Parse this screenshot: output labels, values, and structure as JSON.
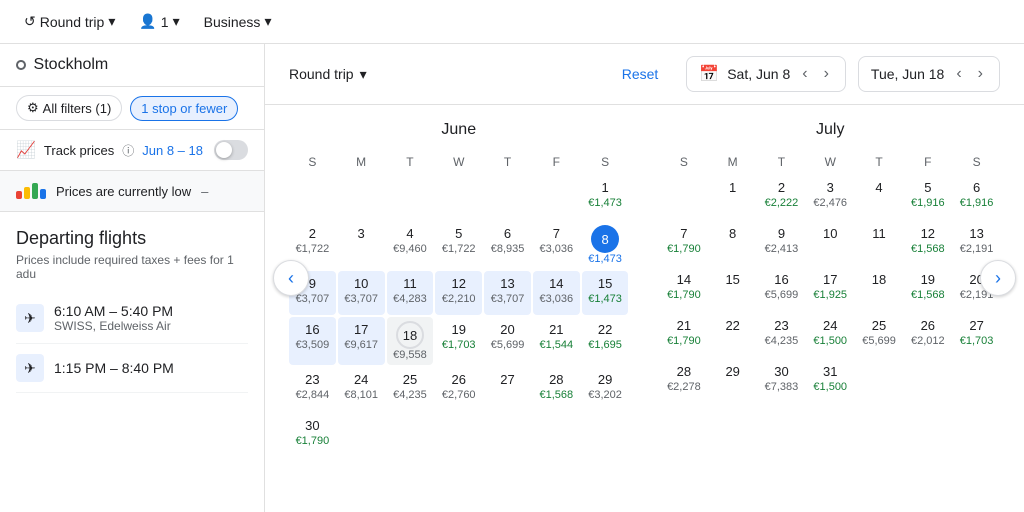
{
  "topBar": {
    "tripType": "Round trip",
    "passengers": "1",
    "cabin": "Business"
  },
  "leftPanel": {
    "searchValue": "Stockholm",
    "filterLabel": "All filters (1)",
    "stopFilter": "1 stop or fewer",
    "trackPrices": "Track prices",
    "trackInfo": "ⓘ",
    "trackDateRange": "Jun 8 – 18",
    "priceBanner": "Prices are currently low",
    "departingTitle": "Departing flights",
    "departingSubtitle": "Prices include required taxes + fees for 1 adu",
    "flights": [
      {
        "time": "6:10 AM – 5:40 PM",
        "airline": "SWISS, Edelweiss Air"
      },
      {
        "time": "1:15 PM – 8:40 PM",
        "airline": ""
      }
    ]
  },
  "calendarHeader": {
    "tripType": "Round trip",
    "resetLabel": "Reset",
    "departing": "Sat, Jun 8",
    "returning": "Tue, Jun 18"
  },
  "juneCalendar": {
    "month": "June",
    "days": [
      "S",
      "M",
      "T",
      "W",
      "T",
      "F",
      "S"
    ],
    "cells": [
      {
        "day": "",
        "price": "",
        "type": "empty"
      },
      {
        "day": "",
        "price": "",
        "type": "empty"
      },
      {
        "day": "",
        "price": "",
        "type": "empty"
      },
      {
        "day": "",
        "price": "",
        "type": "empty"
      },
      {
        "day": "",
        "price": "",
        "type": "empty"
      },
      {
        "day": "",
        "price": "",
        "type": "empty"
      },
      {
        "day": "1",
        "price": "€1,473",
        "type": "low"
      },
      {
        "day": "2",
        "price": "€1,722",
        "type": "normal"
      },
      {
        "day": "3",
        "price": "",
        "type": "normal"
      },
      {
        "day": "4",
        "price": "€9,460",
        "type": "high"
      },
      {
        "day": "5",
        "price": "€1,722",
        "type": "normal"
      },
      {
        "day": "6",
        "price": "€8,935",
        "type": "high"
      },
      {
        "day": "7",
        "price": "€3,036",
        "type": "normal"
      },
      {
        "day": "8",
        "price": "€1,473",
        "type": "selected-start"
      },
      {
        "day": "9",
        "price": "€3,707",
        "type": "in-range"
      },
      {
        "day": "10",
        "price": "€3,707",
        "type": "in-range"
      },
      {
        "day": "11",
        "price": "€4,283",
        "type": "in-range"
      },
      {
        "day": "12",
        "price": "€2,210",
        "type": "in-range"
      },
      {
        "day": "13",
        "price": "€3,707",
        "type": "in-range"
      },
      {
        "day": "14",
        "price": "€3,036",
        "type": "in-range"
      },
      {
        "day": "15",
        "price": "€1,473",
        "type": "in-range-low"
      },
      {
        "day": "16",
        "price": "€3,509",
        "type": "in-range"
      },
      {
        "day": "17",
        "price": "€9,617",
        "type": "in-range"
      },
      {
        "day": "18",
        "price": "€9,558",
        "type": "selected-end"
      },
      {
        "day": "19",
        "price": "€1,703",
        "type": "low"
      },
      {
        "day": "20",
        "price": "€5,699",
        "type": "normal"
      },
      {
        "day": "21",
        "price": "€1,544",
        "type": "low"
      },
      {
        "day": "22",
        "price": "€1,695",
        "type": "low"
      },
      {
        "day": "23",
        "price": "€2,844",
        "type": "normal"
      },
      {
        "day": "24",
        "price": "€8,101",
        "type": "normal"
      },
      {
        "day": "25",
        "price": "€4,235",
        "type": "normal"
      },
      {
        "day": "26",
        "price": "€2,760",
        "type": "normal"
      },
      {
        "day": "27",
        "price": "",
        "type": "normal"
      },
      {
        "day": "28",
        "price": "€1,568",
        "type": "low"
      },
      {
        "day": "29",
        "price": "€3,202",
        "type": "normal"
      },
      {
        "day": "30",
        "price": "€1,790",
        "type": "low"
      },
      {
        "day": "",
        "price": "",
        "type": "empty"
      },
      {
        "day": "",
        "price": "",
        "type": "empty"
      },
      {
        "day": "",
        "price": "",
        "type": "empty"
      },
      {
        "day": "",
        "price": "",
        "type": "empty"
      },
      {
        "day": "",
        "price": "",
        "type": "empty"
      },
      {
        "day": "",
        "price": "",
        "type": "empty"
      }
    ]
  },
  "julyCalendar": {
    "month": "July",
    "days": [
      "S",
      "M",
      "T",
      "W",
      "T",
      "F",
      "S"
    ],
    "cells": [
      {
        "day": "",
        "price": "",
        "type": "empty"
      },
      {
        "day": "1",
        "price": "",
        "type": "normal"
      },
      {
        "day": "2",
        "price": "€2,222",
        "type": "low"
      },
      {
        "day": "3",
        "price": "€2,476",
        "type": "normal"
      },
      {
        "day": "4",
        "price": "",
        "type": "normal"
      },
      {
        "day": "5",
        "price": "€1,916",
        "type": "low"
      },
      {
        "day": "6",
        "price": "€1,916",
        "type": "low"
      },
      {
        "day": "7",
        "price": "€1,790",
        "type": "low"
      },
      {
        "day": "8",
        "price": "",
        "type": "normal"
      },
      {
        "day": "9",
        "price": "€2,413",
        "type": "normal"
      },
      {
        "day": "10",
        "price": "",
        "type": "normal"
      },
      {
        "day": "11",
        "price": "",
        "type": "normal"
      },
      {
        "day": "12",
        "price": "€1,568",
        "type": "low"
      },
      {
        "day": "13",
        "price": "€2,191",
        "type": "normal"
      },
      {
        "day": "14",
        "price": "€1,790",
        "type": "low"
      },
      {
        "day": "15",
        "price": "",
        "type": "normal"
      },
      {
        "day": "16",
        "price": "€5,699",
        "type": "high"
      },
      {
        "day": "17",
        "price": "€1,925",
        "type": "low"
      },
      {
        "day": "18",
        "price": "",
        "type": "normal"
      },
      {
        "day": "19",
        "price": "€1,568",
        "type": "low"
      },
      {
        "day": "20",
        "price": "€2,191",
        "type": "normal"
      },
      {
        "day": "21",
        "price": "€1,790",
        "type": "low"
      },
      {
        "day": "22",
        "price": "",
        "type": "normal"
      },
      {
        "day": "23",
        "price": "€4,235",
        "type": "normal"
      },
      {
        "day": "24",
        "price": "€1,500",
        "type": "low"
      },
      {
        "day": "25",
        "price": "€5,699",
        "type": "high"
      },
      {
        "day": "26",
        "price": "€2,012",
        "type": "normal"
      },
      {
        "day": "27",
        "price": "€1,703",
        "type": "low"
      },
      {
        "day": "28",
        "price": "€2,278",
        "type": "normal"
      },
      {
        "day": "29",
        "price": "",
        "type": "normal"
      },
      {
        "day": "30",
        "price": "€7,383",
        "type": "high"
      },
      {
        "day": "31",
        "price": "€1,500",
        "type": "low"
      },
      {
        "day": "",
        "price": "",
        "type": "empty"
      },
      {
        "day": "",
        "price": "",
        "type": "empty"
      },
      {
        "day": "",
        "price": "",
        "type": "empty"
      },
      {
        "day": "",
        "price": "",
        "type": "empty"
      },
      {
        "day": "",
        "price": "",
        "type": "empty"
      },
      {
        "day": "",
        "price": "",
        "type": "empty"
      },
      {
        "day": "",
        "price": "",
        "type": "empty"
      },
      {
        "day": "",
        "price": "",
        "type": "empty"
      },
      {
        "day": "",
        "price": "",
        "type": "empty"
      },
      {
        "day": "",
        "price": "",
        "type": "empty"
      }
    ]
  },
  "colors": {
    "blue": "#1a73e8",
    "green": "#188038",
    "gray": "#5f6368"
  }
}
